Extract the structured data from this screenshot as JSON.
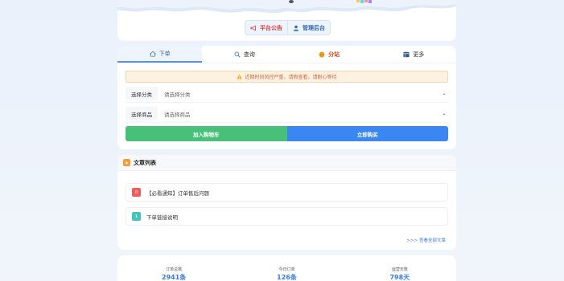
{
  "hero": {
    "platform_notice_label": "平台公告",
    "admin_label": "管理后台",
    "colors": {
      "red": "#e23b3b",
      "blue": "#2f67b6"
    }
  },
  "tabs": [
    {
      "label": "下单",
      "icon": "home-icon",
      "active": true
    },
    {
      "label": "查询",
      "icon": "search-icon",
      "active": false
    },
    {
      "label": "分站",
      "icon": "globe-icon",
      "active": false
    },
    {
      "label": "更多",
      "icon": "grid-icon",
      "active": false
    }
  ],
  "notice": {
    "text": "近期时间风控严重，请假查看，请耐心等待"
  },
  "form": {
    "category": {
      "label": "选择分类",
      "value": "请选择分类"
    },
    "product": {
      "label": "选择商品",
      "value": "请选择商品"
    },
    "add_to_cart_label": "加入购物车",
    "buy_now_label": "立即购买"
  },
  "articles": {
    "title": "文章列表",
    "items": [
      {
        "index": "0",
        "title": "【必看通知】订单售后问题",
        "badge_color": "#f25c5c"
      },
      {
        "index": "1",
        "title": "下单链接说明",
        "badge_color": "#43c6b7"
      }
    ],
    "view_all_label": ">>> 查看全部文章"
  },
  "stats": [
    {
      "label": "订单总数",
      "value": "2941条"
    },
    {
      "label": "今日订单",
      "value": "126条"
    },
    {
      "label": "运营天数",
      "value": "798天"
    }
  ]
}
